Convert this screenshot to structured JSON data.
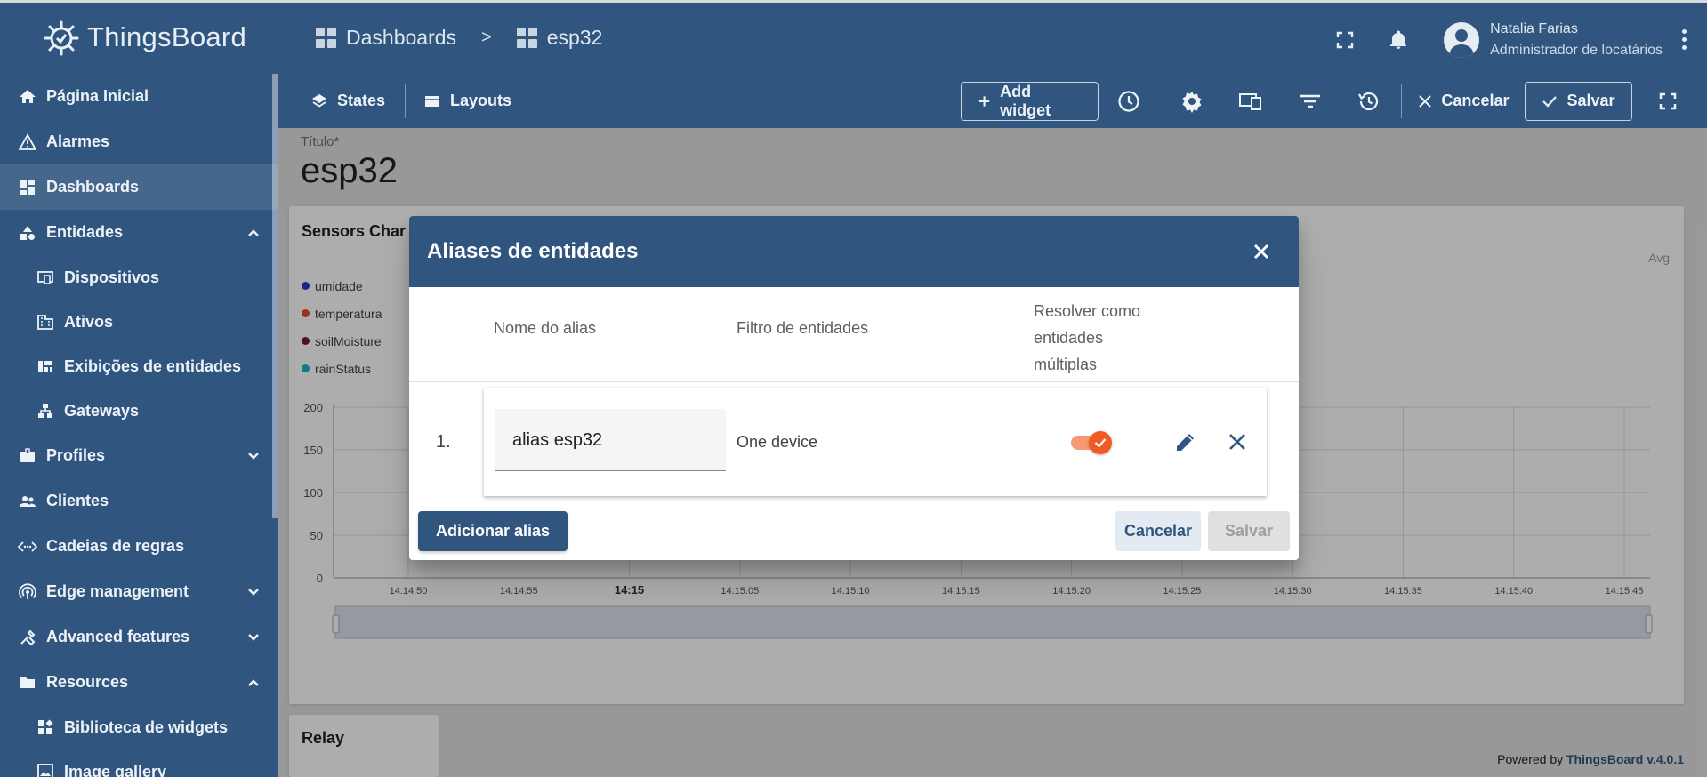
{
  "header": {
    "brand": "ThingsBoard",
    "breadcrumb": [
      {
        "label": "Dashboards"
      },
      {
        "label": "esp32"
      }
    ],
    "breadcrumb_separator": ">",
    "user": {
      "name": "Natalia Farias",
      "role": "Administrador de locatários"
    }
  },
  "sidebar": {
    "items": [
      {
        "label": "Página Inicial",
        "icon": "home-icon"
      },
      {
        "label": "Alarmes",
        "icon": "warning-icon"
      },
      {
        "label": "Dashboards",
        "icon": "dashboard-icon",
        "active": true
      },
      {
        "label": "Entidades",
        "icon": "entities-icon",
        "expanded": true
      },
      {
        "label": "Dispositivos",
        "icon": "devices-icon",
        "sub": true
      },
      {
        "label": "Ativos",
        "icon": "domain-icon",
        "sub": true
      },
      {
        "label": "Exibições de entidades",
        "icon": "view-quilt-icon",
        "sub": true
      },
      {
        "label": "Gateways",
        "icon": "gateway-icon",
        "sub": true
      },
      {
        "label": "Profiles",
        "icon": "badge-icon",
        "expanded": false
      },
      {
        "label": "Clientes",
        "icon": "people-icon"
      },
      {
        "label": "Cadeias de regras",
        "icon": "settings-ethernet-icon"
      },
      {
        "label": "Edge management",
        "icon": "router-icon",
        "expanded": false
      },
      {
        "label": "Advanced features",
        "icon": "construction-icon",
        "expanded": false
      },
      {
        "label": "Resources",
        "icon": "folder-icon",
        "expanded": true
      },
      {
        "label": "Biblioteca de widgets",
        "icon": "widgets-icon",
        "sub": true
      },
      {
        "label": "Image gallery",
        "icon": "image-icon",
        "sub": true
      }
    ]
  },
  "toolbar": {
    "states": "States",
    "layouts": "Layouts",
    "add_widget": "Add widget",
    "cancel": "Cancelar",
    "save": "Salvar"
  },
  "dashboard": {
    "title_label": "Título*",
    "title": "esp32",
    "chart_widget_title": "Sensors Char",
    "legend": [
      {
        "name": "umidade",
        "color": "#1e3bd6"
      },
      {
        "name": "temperatura",
        "color": "#e8492e"
      },
      {
        "name": "soilMoisture",
        "color": "#7a1830"
      },
      {
        "name": "rainStatus",
        "color": "#17b5d3"
      }
    ],
    "avg_label": "Avg",
    "relay_widget_title": "Relay",
    "footer_powered": "Powered by ",
    "footer_link": "ThingsBoard v.4.0.1"
  },
  "chart_data": {
    "type": "line",
    "y_ticks": [
      "200",
      "150",
      "100",
      "50",
      "0"
    ],
    "x_ticks": [
      "14:14:50",
      "14:14:55",
      "14:15",
      "14:15:05",
      "14:15:10",
      "14:15:15",
      "14:15:20",
      "14:15:25",
      "14:15:30",
      "14:15:35",
      "14:15:40",
      "14:15:45"
    ],
    "ylim": [
      0,
      200
    ],
    "grid": true,
    "legend_position": "top-left",
    "series": [
      {
        "name": "umidade",
        "values": []
      },
      {
        "name": "temperatura",
        "values": []
      },
      {
        "name": "soilMoisture",
        "values": []
      },
      {
        "name": "rainStatus",
        "values": []
      }
    ]
  },
  "dialog": {
    "title": "Aliases de entidades",
    "columns": {
      "alias_name": "Nome do alias",
      "entity_filter": "Filtro de entidades",
      "resolve_multiple_1": "Resolver como",
      "resolve_multiple_2": "entidades",
      "resolve_multiple_3": "múltiplas"
    },
    "rows": [
      {
        "index": "1.",
        "alias": "alias esp32",
        "filter": "One device",
        "resolve_multiple": true
      }
    ],
    "add_alias": "Adicionar alias",
    "cancel": "Cancelar",
    "save": "Salvar"
  },
  "colors": {
    "primary": "#305680",
    "accent": "#f15a22"
  }
}
